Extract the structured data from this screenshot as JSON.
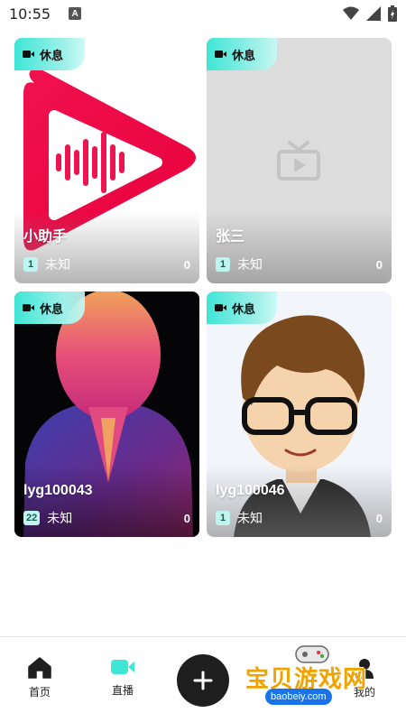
{
  "status_bar": {
    "time": "10:55",
    "notification_letter": "A"
  },
  "cards": [
    {
      "badge": "休息",
      "name": "小助手",
      "level": "1",
      "status": "未知",
      "count": "0"
    },
    {
      "badge": "休息",
      "name": "张三",
      "level": "1",
      "status": "未知",
      "count": "0"
    },
    {
      "badge": "休息",
      "name": "lyg100043",
      "level": "22",
      "status": "未知",
      "count": "0"
    },
    {
      "badge": "休息",
      "name": "lyg100046",
      "level": "1",
      "status": "未知",
      "count": "0"
    }
  ],
  "nav": {
    "home": "首页",
    "live": "直播",
    "mine": "我的"
  },
  "watermark": {
    "title": "宝贝游戏网",
    "url": "baobeiy.com"
  },
  "colors": {
    "accent": "#3ee6d6",
    "level_bg": "#bff4ef",
    "add_button": "#1e1e1e"
  }
}
